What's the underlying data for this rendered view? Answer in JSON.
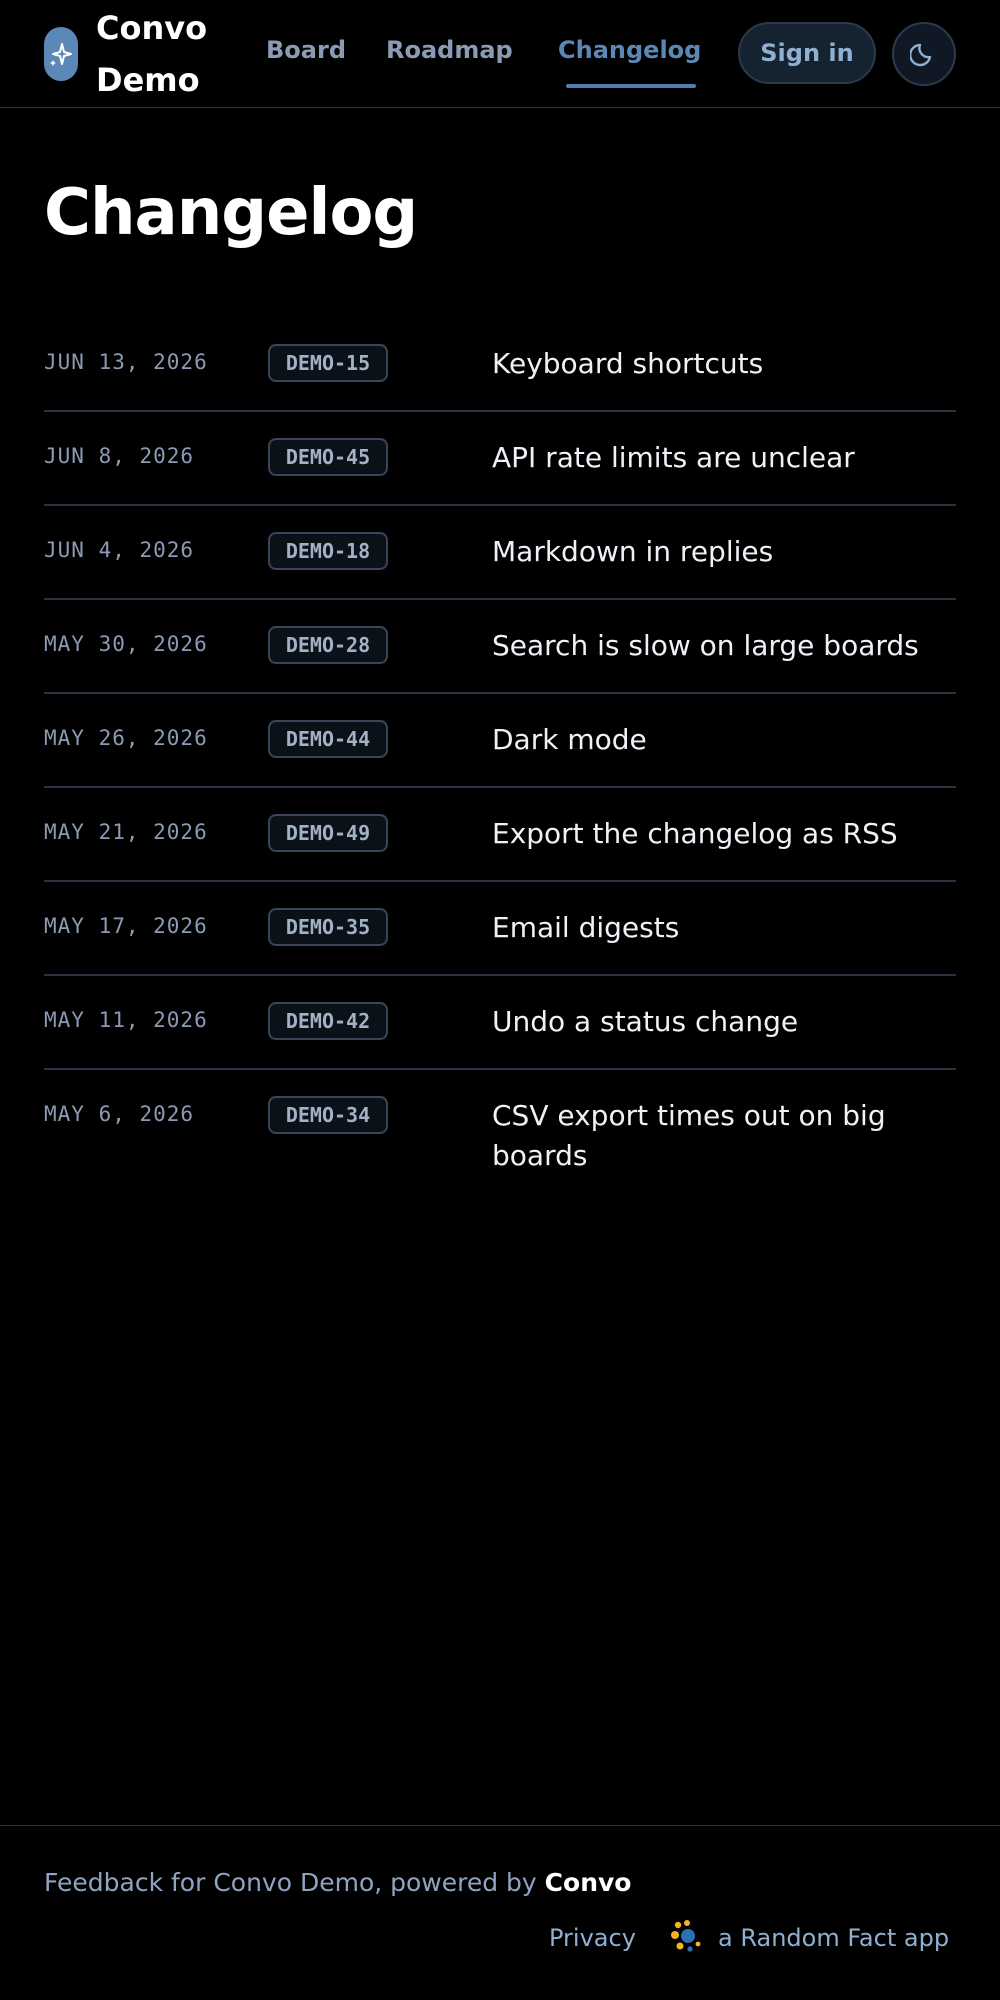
{
  "header": {
    "brand_name": "Convo Demo",
    "logo_icon": "sparkle-icon",
    "nav": [
      {
        "label": "Board"
      },
      {
        "label": "Roadmap"
      },
      {
        "label": "Changelog",
        "active": true
      }
    ],
    "sign_in_label": "Sign in",
    "theme_icon": "moon-icon"
  },
  "page": {
    "title": "Changelog"
  },
  "entries": [
    {
      "date": "JUN 13, 2026",
      "id": "DEMO-15",
      "title": "Keyboard shortcuts"
    },
    {
      "date": "JUN 8, 2026",
      "id": "DEMO-45",
      "title": "API rate limits are unclear"
    },
    {
      "date": "JUN 4, 2026",
      "id": "DEMO-18",
      "title": "Markdown in replies"
    },
    {
      "date": "MAY 30, 2026",
      "id": "DEMO-28",
      "title": "Search is slow on large boards"
    },
    {
      "date": "MAY 26, 2026",
      "id": "DEMO-44",
      "title": "Dark mode"
    },
    {
      "date": "MAY 21, 2026",
      "id": "DEMO-49",
      "title": "Export the changelog as RSS"
    },
    {
      "date": "MAY 17, 2026",
      "id": "DEMO-35",
      "title": "Email digests"
    },
    {
      "date": "MAY 11, 2026",
      "id": "DEMO-42",
      "title": "Undo a status change"
    },
    {
      "date": "MAY 6, 2026",
      "id": "DEMO-34",
      "title": "CSV export times out on big boards"
    }
  ],
  "footer": {
    "powered_prefix": "Feedback for Convo Demo, powered by ",
    "powered_brand": "Convo",
    "privacy_label": "Privacy",
    "made_by_label": "a Random Fact app",
    "made_by_icon": "random-fact-logo-icon"
  },
  "colors": {
    "background": "#000000",
    "accent": "#5b88b6",
    "muted_text": "#8b9bb4",
    "divider": "#2a3442"
  }
}
